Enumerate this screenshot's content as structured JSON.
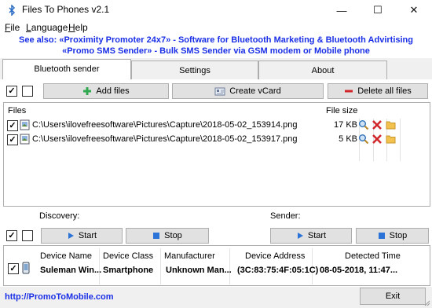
{
  "window": {
    "title": "Files To Phones v2.1",
    "controls": {
      "minimize": "—",
      "maximize": "☐",
      "close": "✕"
    }
  },
  "menu": {
    "items": [
      {
        "underline": "F",
        "rest": "ile"
      },
      {
        "underline": "L",
        "rest": "anguage"
      },
      {
        "underline": "H",
        "rest": "elp"
      }
    ]
  },
  "promo": {
    "line1": "See also: «Proximity Promoter 24x7» - Software for Bluetooth Marketing & Bluetooth Advirtising",
    "line2": "«Promo SMS Sender» - Bulk SMS Sender via GSM modem or Mobile phone"
  },
  "tabs": [
    "Bluetooth sender",
    "Settings",
    "About"
  ],
  "toolbar": {
    "add_files": "Add files",
    "create_vcard": "Create vCard",
    "delete_all": "Delete all files"
  },
  "files": {
    "header_files": "Files",
    "header_size": "File size",
    "rows": [
      {
        "checked": "✓",
        "path": "C:\\Users\\ilovefreesoftware\\Pictures\\Capture\\2018-05-02_153914.png",
        "size": "17 KB"
      },
      {
        "checked": "✓",
        "path": "C:\\Users\\ilovefreesoftware\\Pictures\\Capture\\2018-05-02_153917.png",
        "size": "5 KB"
      }
    ]
  },
  "discovery": {
    "label": "Discovery:",
    "start": "Start",
    "stop": "Stop"
  },
  "sender": {
    "label": "Sender:",
    "start": "Start",
    "stop": "Stop"
  },
  "devices": {
    "columns": [
      "Device Name",
      "Device Class",
      "Manufacturer",
      "Device Address",
      "Detected Time"
    ],
    "rows": [
      {
        "checked": "✓",
        "name": "Suleman Win...",
        "class": "Smartphone",
        "manufacturer": "Unknown Man...",
        "address": "(3C:83:75:4F:05:1C)",
        "time": "08-05-2018, 11:47..."
      }
    ]
  },
  "footer": {
    "link": "http://PromoToMobile.com",
    "exit": "Exit"
  },
  "colors": {
    "link": "#1a2fe6",
    "delete_red": "#d0262a",
    "add_green": "#2fa84f",
    "play_blue": "#2b73d6"
  }
}
